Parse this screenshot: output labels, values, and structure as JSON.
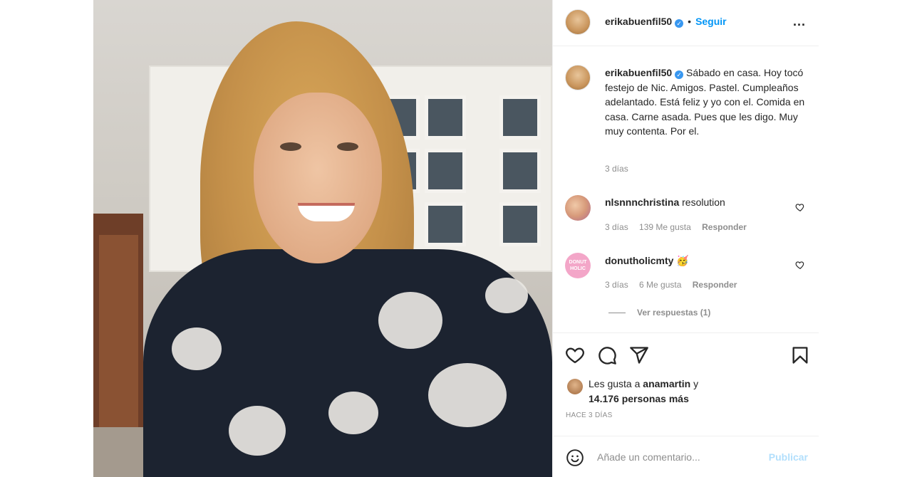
{
  "post": {
    "username": "erikabuenfil50",
    "follow_label": "Seguir",
    "separator": "•",
    "more_icon": "...",
    "caption": "Sábado en casa. Hoy tocó festejo de Nic. Amigos. Pastel. Cumpleaños adelantado. Está feliz y yo con el. Comida en casa. Carne asada. Pues que les digo. Muy muy contenta. Por el.",
    "caption_time": "3 días"
  },
  "comments": [
    {
      "username": "nlsnnnchristina",
      "text": "resolution",
      "time": "3 días",
      "likes": "139 Me gusta",
      "reply": "Responder"
    },
    {
      "username": "donutholicmty",
      "text": "🥳",
      "time": "3 días",
      "likes": "6 Me gusta",
      "reply": "Responder",
      "avatar_text": "DONUT HOLIC"
    }
  ],
  "view_replies": "Ver respuestas (1)",
  "likes": {
    "prefix": "Les gusta a",
    "user": "anamartin",
    "conj": "y",
    "count": "14.176 personas más"
  },
  "post_time": "HACE 3 DÍAS",
  "comment_box": {
    "placeholder": "Añade un comentario...",
    "publish": "Publicar"
  },
  "colors": {
    "accent": "#0095f6",
    "publish_disabled": "#b2dffc",
    "verified": "#3897f0"
  }
}
